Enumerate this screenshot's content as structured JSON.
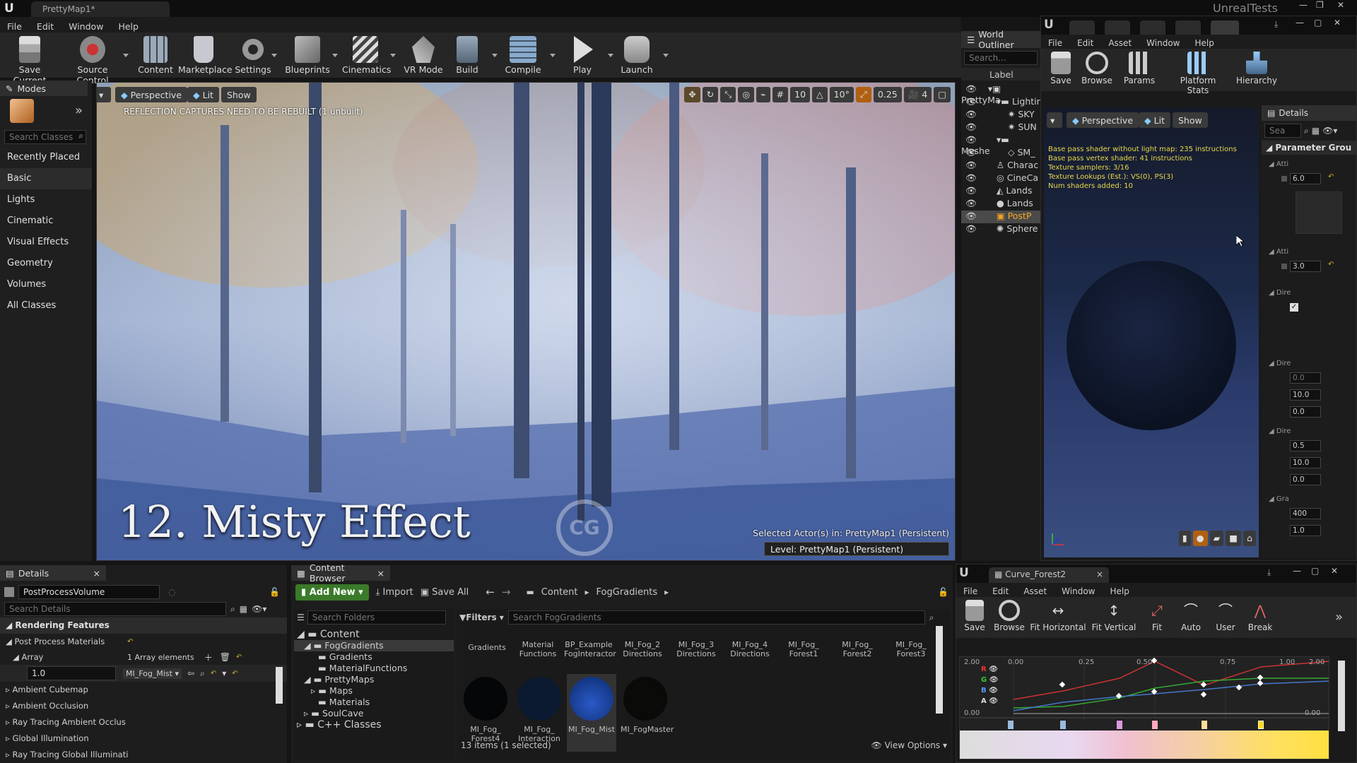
{
  "window": {
    "doc_tab": "PrettyMap1*",
    "app_title": "UnrealTests"
  },
  "menu": [
    "File",
    "Edit",
    "Window",
    "Help"
  ],
  "toolbar": [
    {
      "label": "Save Current",
      "icon": "save-icon"
    },
    {
      "label": "Source Control",
      "icon": "source-control-icon"
    },
    {
      "label": "Content",
      "icon": "content-icon"
    },
    {
      "label": "Marketplace",
      "icon": "marketplace-icon"
    },
    {
      "label": "Settings",
      "icon": "settings-icon"
    },
    {
      "label": "Blueprints",
      "icon": "blueprints-icon"
    },
    {
      "label": "Cinematics",
      "icon": "cinematics-icon"
    },
    {
      "label": "VR Mode",
      "icon": "vr-icon"
    },
    {
      "label": "Build",
      "icon": "build-icon"
    },
    {
      "label": "Compile",
      "icon": "compile-icon"
    },
    {
      "label": "Play",
      "icon": "play-icon"
    },
    {
      "label": "Launch",
      "icon": "launch-icon"
    }
  ],
  "modes": {
    "tab": "Modes",
    "search_placeholder": "Search Classes",
    "items": [
      "Recently Placed",
      "Basic",
      "Lights",
      "Cinematic",
      "Visual Effects",
      "Geometry",
      "Volumes",
      "All Classes"
    ]
  },
  "viewport": {
    "perspective": "Perspective",
    "lit": "Lit",
    "show": "Show",
    "warning": "REFLECTION CAPTURES NEED TO BE REBUILT (1 unbuilt)",
    "grid_snap": "10",
    "rot_snap": "10°",
    "scale_snap": "0.25",
    "cam_speed": "4",
    "overlay_title": "12. Misty Effect",
    "selected_actor": "Selected Actor(s) in:  PrettyMap1 (Persistent)",
    "level": "Level:  PrettyMap1 (Persistent)",
    "watermark": "CG"
  },
  "outliner": {
    "tab": "World Outliner",
    "search_placeholder": "Search...",
    "column": "Label",
    "rows": [
      "PrettyMa",
      "Lightir",
      "SKY",
      "SUN",
      "Meshe",
      "SM_",
      "Charac",
      "CineCa",
      "Lands",
      "Lands",
      "PostP",
      "Sphere"
    ]
  },
  "material_editor": {
    "menu": [
      "File",
      "Edit",
      "Asset",
      "Window",
      "Help"
    ],
    "toolbar": [
      "Save",
      "Browse",
      "Params",
      "Platform Stats",
      "Hierarchy"
    ],
    "perspective": "Perspective",
    "lit": "Lit",
    "show": "Show",
    "stats": [
      "Base pass shader without light map: 235 instructions",
      "Base pass vertex shader: 41 instructions",
      "Texture samplers: 3/16",
      "Texture Lookups (Est.): VS(0), PS(3)",
      "Num shaders added: 10"
    ],
    "details_tab": "Details",
    "search_placeholder": "Sea",
    "parameter_groups": "Parameter Grou",
    "groups": [
      "Atti",
      "Atti",
      "Dire",
      "Dire",
      "Dire",
      "Gra"
    ],
    "values": [
      "6.0",
      "3.0",
      "0.0",
      "10.0",
      "0.0",
      "0.5",
      "10.0",
      "0.0",
      "400",
      "1.0"
    ]
  },
  "details": {
    "tab": "Details",
    "object_name": "PostProcessVolume",
    "search_placeholder": "Search Details",
    "section": "Rendering Features",
    "post_process_materials": "Post Process Materials",
    "array_label": "Array",
    "array_count": "1 Array elements",
    "weight": "1.0",
    "material": "MI_Fog_Mist",
    "categories": [
      "Ambient Cubemap",
      "Ambient Occlusion",
      "Ray Tracing Ambient Occlus",
      "Global Illumination",
      "Ray Tracing Global Illuminati"
    ]
  },
  "content_browser": {
    "tab": "Content Browser",
    "add_new": "Add New",
    "import": "Import",
    "save_all": "Save All",
    "path": [
      "Content",
      "FogGradients"
    ],
    "folders_search": "Search Folders",
    "filters": "Filters",
    "assets_search": "Search FogGradients",
    "tree": [
      {
        "label": "Content",
        "level": 0
      },
      {
        "label": "FogGradients",
        "level": 1
      },
      {
        "label": "Gradients",
        "level": 2
      },
      {
        "label": "MaterialFunctions",
        "level": 2
      },
      {
        "label": "PrettyMaps",
        "level": 1
      },
      {
        "label": "Maps",
        "level": 2
      },
      {
        "label": "Materials",
        "level": 2
      },
      {
        "label": "SoulCave",
        "level": 1
      },
      {
        "label": "C++ Classes",
        "level": 0
      }
    ],
    "top_row": [
      "Gradients",
      "Material Functions",
      "BP_Example FogInteractor",
      "MI_Fog_2 Directions",
      "MI_Fog_3 Directions",
      "MI_Fog_4 Directions",
      "MI_Fog_ Forest1",
      "MI_Fog_ Forest2",
      "MI_Fog_ Forest3"
    ],
    "bottom_row": [
      {
        "label": "MI_Fog_ Forest4",
        "color": "#050608"
      },
      {
        "label": "MI_Fog_ Interaction",
        "color": "#0b1a30"
      },
      {
        "label": "MI_Fog_Mist",
        "color": "#1a47a8"
      },
      {
        "label": "MI_FogMaster",
        "color": "#0a0a08"
      }
    ],
    "status": "13 items (1 selected)",
    "view_options": "View Options"
  },
  "curve_editor": {
    "tab": "Curve_Forest2",
    "menu": [
      "File",
      "Edit",
      "Asset",
      "Window",
      "Help"
    ],
    "toolbar": [
      "Save",
      "Browse",
      "Fit Horizontal",
      "Fit Vertical",
      "Fit",
      "Auto",
      "User",
      "Break"
    ],
    "x_ticks": [
      "0.00",
      "0.25",
      "0.50",
      "0.75",
      "1.00",
      "2.00"
    ],
    "y_top": "2.00",
    "y_bottom": "0.00",
    "y_bottom_right": "0.00",
    "channels": [
      "R",
      "G",
      "B",
      "A"
    ]
  }
}
